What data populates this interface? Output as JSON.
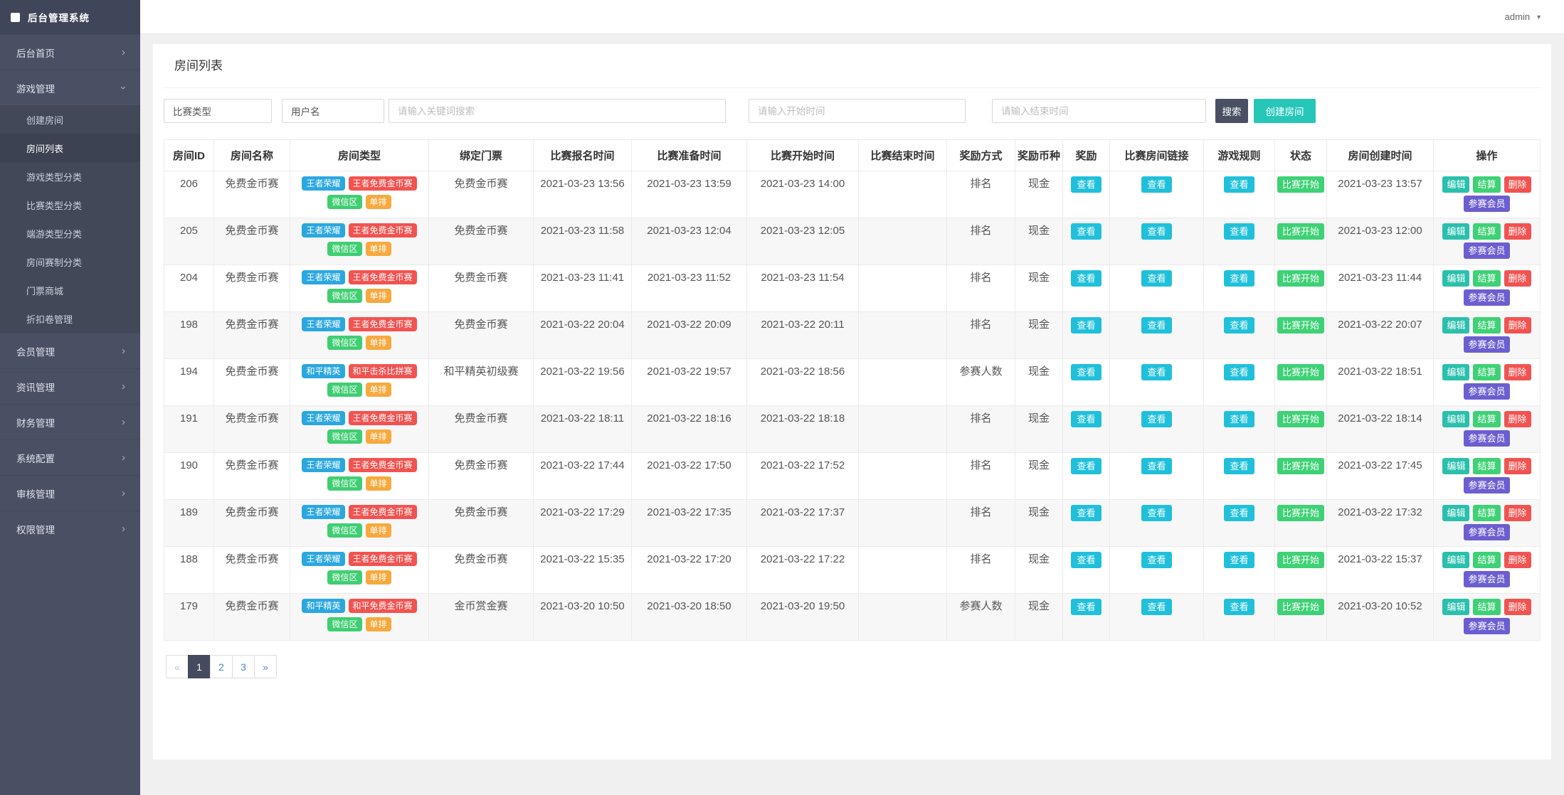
{
  "app": {
    "title": "后台管理系统",
    "user": "admin"
  },
  "sidebar": {
    "items": [
      {
        "label": "后台首页",
        "expanded": false
      },
      {
        "label": "游戏管理",
        "expanded": true,
        "children": [
          "创建房间",
          "房间列表",
          "游戏类型分类",
          "比赛类型分类",
          "端游类型分类",
          "房间赛制分类",
          "门票商城",
          "折扣卷管理"
        ],
        "active_child": "房间列表"
      },
      {
        "label": "会员管理",
        "expanded": false
      },
      {
        "label": "资讯管理",
        "expanded": false
      },
      {
        "label": "财务管理",
        "expanded": false
      },
      {
        "label": "系统配置",
        "expanded": false
      },
      {
        "label": "审核管理",
        "expanded": false
      },
      {
        "label": "权限管理",
        "expanded": false
      }
    ]
  },
  "page": {
    "title": "房间列表"
  },
  "filters": {
    "match_type_value": "比赛类型",
    "username_value": "用户名",
    "keyword_placeholder": "请输入关键词搜索",
    "start_time_placeholder": "请输入开始时间",
    "end_time_placeholder": "请输入结束时间",
    "search_label": "搜索",
    "create_room_label": "创建房间"
  },
  "table": {
    "columns": [
      "房间ID",
      "房间名称",
      "房间类型",
      "绑定门票",
      "比赛报名时间",
      "比赛准备时间",
      "比赛开始时间",
      "比赛结束时间",
      "奖励方式",
      "奖励币种",
      "奖励",
      "比赛房间链接",
      "游戏规则",
      "状态",
      "房间创建时间",
      "操作"
    ],
    "view_label": "查看",
    "status_label": "比赛开始",
    "action_labels": [
      "编辑",
      "结算",
      "删除",
      "参赛会员"
    ],
    "rows": [
      {
        "id": "206",
        "name": "免费金币赛",
        "tags": [
          "王者荣耀",
          "王者免费金币赛",
          "微信区",
          "单排"
        ],
        "ticket": "免费金币赛",
        "signup": "2021-03-23 13:56",
        "prepare": "2021-03-23 13:59",
        "start": "2021-03-23 14:00",
        "end": "",
        "reward_mode": "排名",
        "currency": "现金",
        "created": "2021-03-23 13:57"
      },
      {
        "id": "205",
        "name": "免费金币赛",
        "tags": [
          "王者荣耀",
          "王者免费金币赛",
          "微信区",
          "单排"
        ],
        "ticket": "免费金币赛",
        "signup": "2021-03-23 11:58",
        "prepare": "2021-03-23 12:04",
        "start": "2021-03-23 12:05",
        "end": "",
        "reward_mode": "排名",
        "currency": "现金",
        "created": "2021-03-23 12:00"
      },
      {
        "id": "204",
        "name": "免费金币赛",
        "tags": [
          "王者荣耀",
          "王者免费金币赛",
          "微信区",
          "单排"
        ],
        "ticket": "免费金币赛",
        "signup": "2021-03-23 11:41",
        "prepare": "2021-03-23 11:52",
        "start": "2021-03-23 11:54",
        "end": "",
        "reward_mode": "排名",
        "currency": "现金",
        "created": "2021-03-23 11:44"
      },
      {
        "id": "198",
        "name": "免费金币赛",
        "tags": [
          "王者荣耀",
          "王者免费金币赛",
          "微信区",
          "单排"
        ],
        "ticket": "免费金币赛",
        "signup": "2021-03-22 20:04",
        "prepare": "2021-03-22 20:09",
        "start": "2021-03-22 20:11",
        "end": "",
        "reward_mode": "排名",
        "currency": "现金",
        "created": "2021-03-22 20:07"
      },
      {
        "id": "194",
        "name": "免费金币赛",
        "tags": [
          "和平精英",
          "和平击杀比拼赛",
          "微信区",
          "单排"
        ],
        "ticket": "和平精英初级赛",
        "signup": "2021-03-22 19:56",
        "prepare": "2021-03-22 19:57",
        "start": "2021-03-22 18:56",
        "end": "",
        "reward_mode": "参赛人数",
        "currency": "现金",
        "created": "2021-03-22 18:51"
      },
      {
        "id": "191",
        "name": "免费金币赛",
        "tags": [
          "王者荣耀",
          "王者免费金币赛",
          "微信区",
          "单排"
        ],
        "ticket": "免费金币赛",
        "signup": "2021-03-22 18:11",
        "prepare": "2021-03-22 18:16",
        "start": "2021-03-22 18:18",
        "end": "",
        "reward_mode": "排名",
        "currency": "现金",
        "created": "2021-03-22 18:14"
      },
      {
        "id": "190",
        "name": "免费金币赛",
        "tags": [
          "王者荣耀",
          "王者免费金币赛",
          "微信区",
          "单排"
        ],
        "ticket": "免费金币赛",
        "signup": "2021-03-22 17:44",
        "prepare": "2021-03-22 17:50",
        "start": "2021-03-22 17:52",
        "end": "",
        "reward_mode": "排名",
        "currency": "现金",
        "created": "2021-03-22 17:45"
      },
      {
        "id": "189",
        "name": "免费金币赛",
        "tags": [
          "王者荣耀",
          "王者免费金币赛",
          "微信区",
          "单排"
        ],
        "ticket": "免费金币赛",
        "signup": "2021-03-22 17:29",
        "prepare": "2021-03-22 17:35",
        "start": "2021-03-22 17:37",
        "end": "",
        "reward_mode": "排名",
        "currency": "现金",
        "created": "2021-03-22 17:32"
      },
      {
        "id": "188",
        "name": "免费金币赛",
        "tags": [
          "王者荣耀",
          "王者免费金币赛",
          "微信区",
          "单排"
        ],
        "ticket": "免费金币赛",
        "signup": "2021-03-22 15:35",
        "prepare": "2021-03-22 17:20",
        "start": "2021-03-22 17:22",
        "end": "",
        "reward_mode": "排名",
        "currency": "现金",
        "created": "2021-03-22 15:37"
      },
      {
        "id": "179",
        "name": "免费金币赛",
        "tags": [
          "和平精英",
          "和平免费金币赛",
          "微信区",
          "单排"
        ],
        "ticket": "金币赏金赛",
        "signup": "2021-03-20 10:50",
        "prepare": "2021-03-20 18:50",
        "start": "2021-03-20 19:50",
        "end": "",
        "reward_mode": "参赛人数",
        "currency": "现金",
        "created": "2021-03-20 10:52"
      }
    ]
  },
  "pagination": {
    "items": [
      "«",
      "1",
      "2",
      "3",
      "»"
    ],
    "active": "1",
    "disabled": "«"
  },
  "colors": {
    "sidebar": "#4a5064",
    "search": "#4a5064",
    "create": "#26c6b9",
    "tag_blue": "#2ba7e0",
    "tag_red": "#f25350",
    "tag_green": "#3fce72",
    "tag_orange": "#f7a93d",
    "view": "#20c0db",
    "status": "#3ed176",
    "edit": "#2ac0ad",
    "settle": "#3ed176",
    "del": "#f25350",
    "member": "#6c5ed0"
  }
}
